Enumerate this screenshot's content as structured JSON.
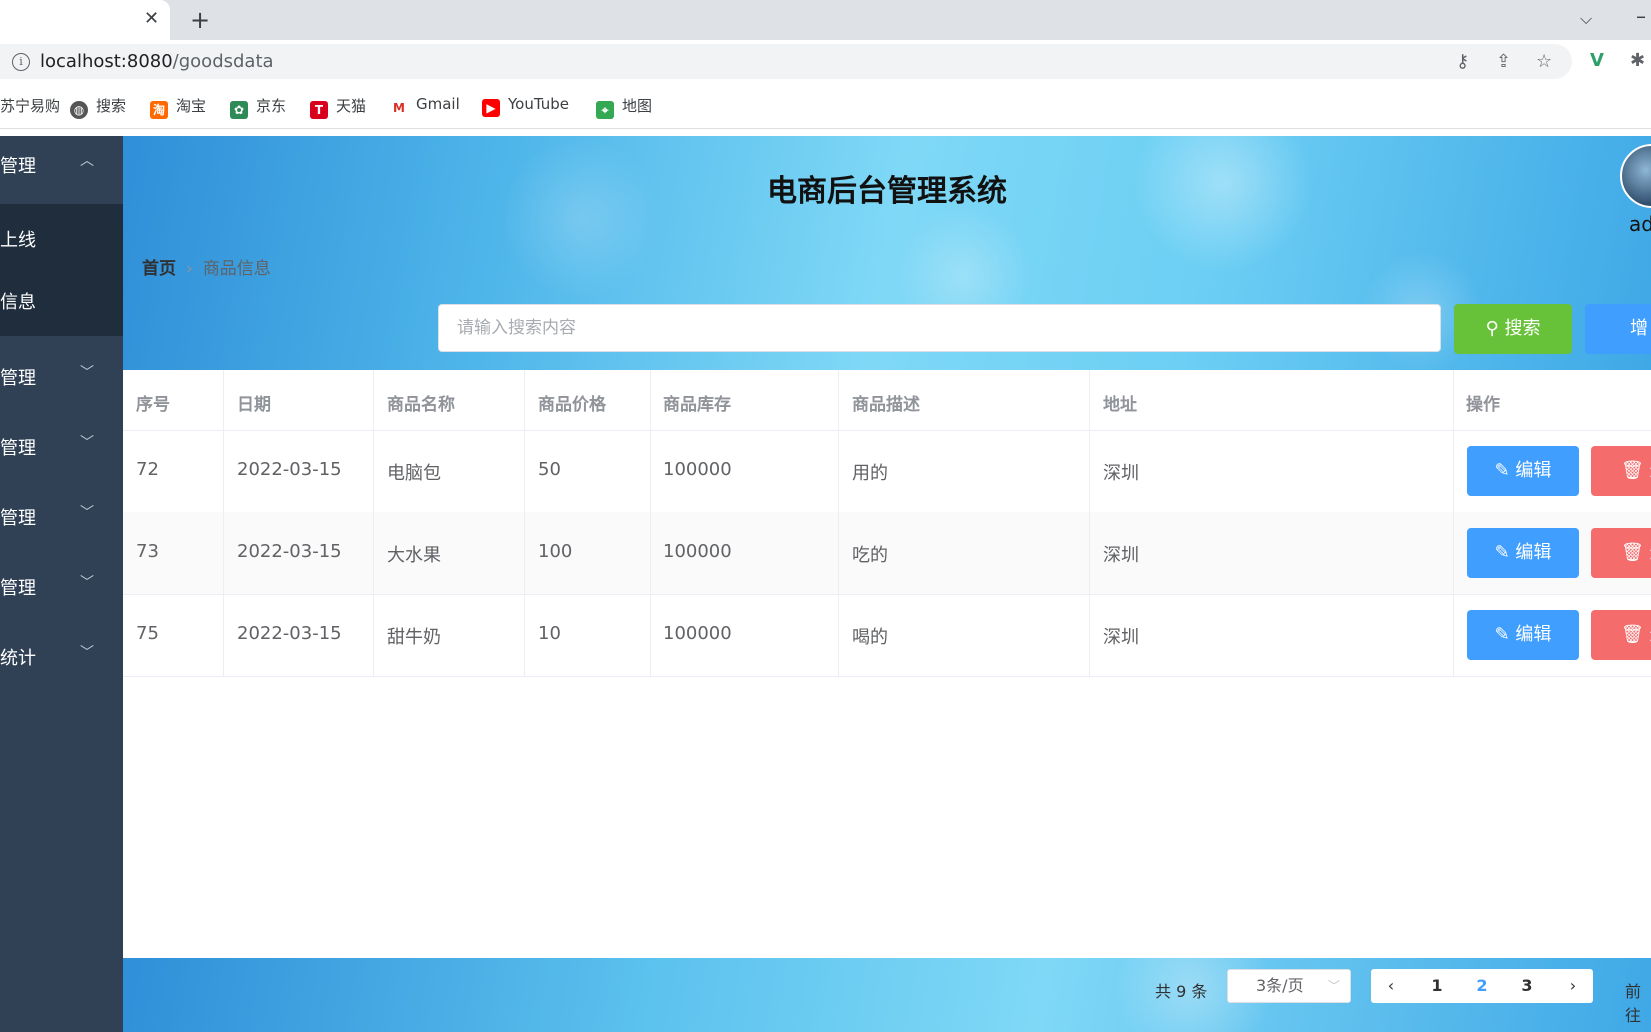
{
  "browser": {
    "url_host": "localhost:8080",
    "url_path": "/goodsdata",
    "bookmarks": [
      "苏宁易购",
      "搜索",
      "淘宝",
      "京东",
      "天猫",
      "Gmail",
      "YouTube",
      "地图"
    ]
  },
  "sidebar": {
    "items": [
      {
        "label": "管理"
      },
      {
        "label": "管理"
      },
      {
        "label": "管理"
      },
      {
        "label": "管理"
      },
      {
        "label": "管理"
      },
      {
        "label": "统计"
      }
    ],
    "subitems": [
      {
        "label": "上线"
      },
      {
        "label": "信息"
      }
    ]
  },
  "header": {
    "title": "电商后台管理系统",
    "username": "ad"
  },
  "breadcrumb": {
    "home": "首页",
    "current": "商品信息"
  },
  "search": {
    "placeholder": "请输入搜索内容",
    "search_label": "搜索",
    "add_label": "增"
  },
  "table": {
    "columns": [
      "序号",
      "日期",
      "商品名称",
      "商品价格",
      "商品库存",
      "商品描述",
      "地址",
      "操作"
    ],
    "rows": [
      {
        "id": "72",
        "date": "2022-03-15",
        "name": "电脑包",
        "price": "50",
        "stock": "100000",
        "desc": "用的",
        "address": "深圳"
      },
      {
        "id": "73",
        "date": "2022-03-15",
        "name": "大水果",
        "price": "100",
        "stock": "100000",
        "desc": "吃的",
        "address": "深圳"
      },
      {
        "id": "75",
        "date": "2022-03-15",
        "name": "甜牛奶",
        "price": "10",
        "stock": "100000",
        "desc": "喝的",
        "address": "深圳"
      }
    ],
    "edit_label": "编辑",
    "delete_label": "删"
  },
  "pagination": {
    "total": "共 9 条",
    "page_size": "3条/页",
    "pages": [
      "1",
      "2",
      "3"
    ],
    "current_page": "2",
    "jump_label": "前往"
  },
  "colors": {
    "sidebar": "#304156",
    "primary": "#409eff",
    "success": "#67c23a",
    "danger": "#f56c6c"
  }
}
